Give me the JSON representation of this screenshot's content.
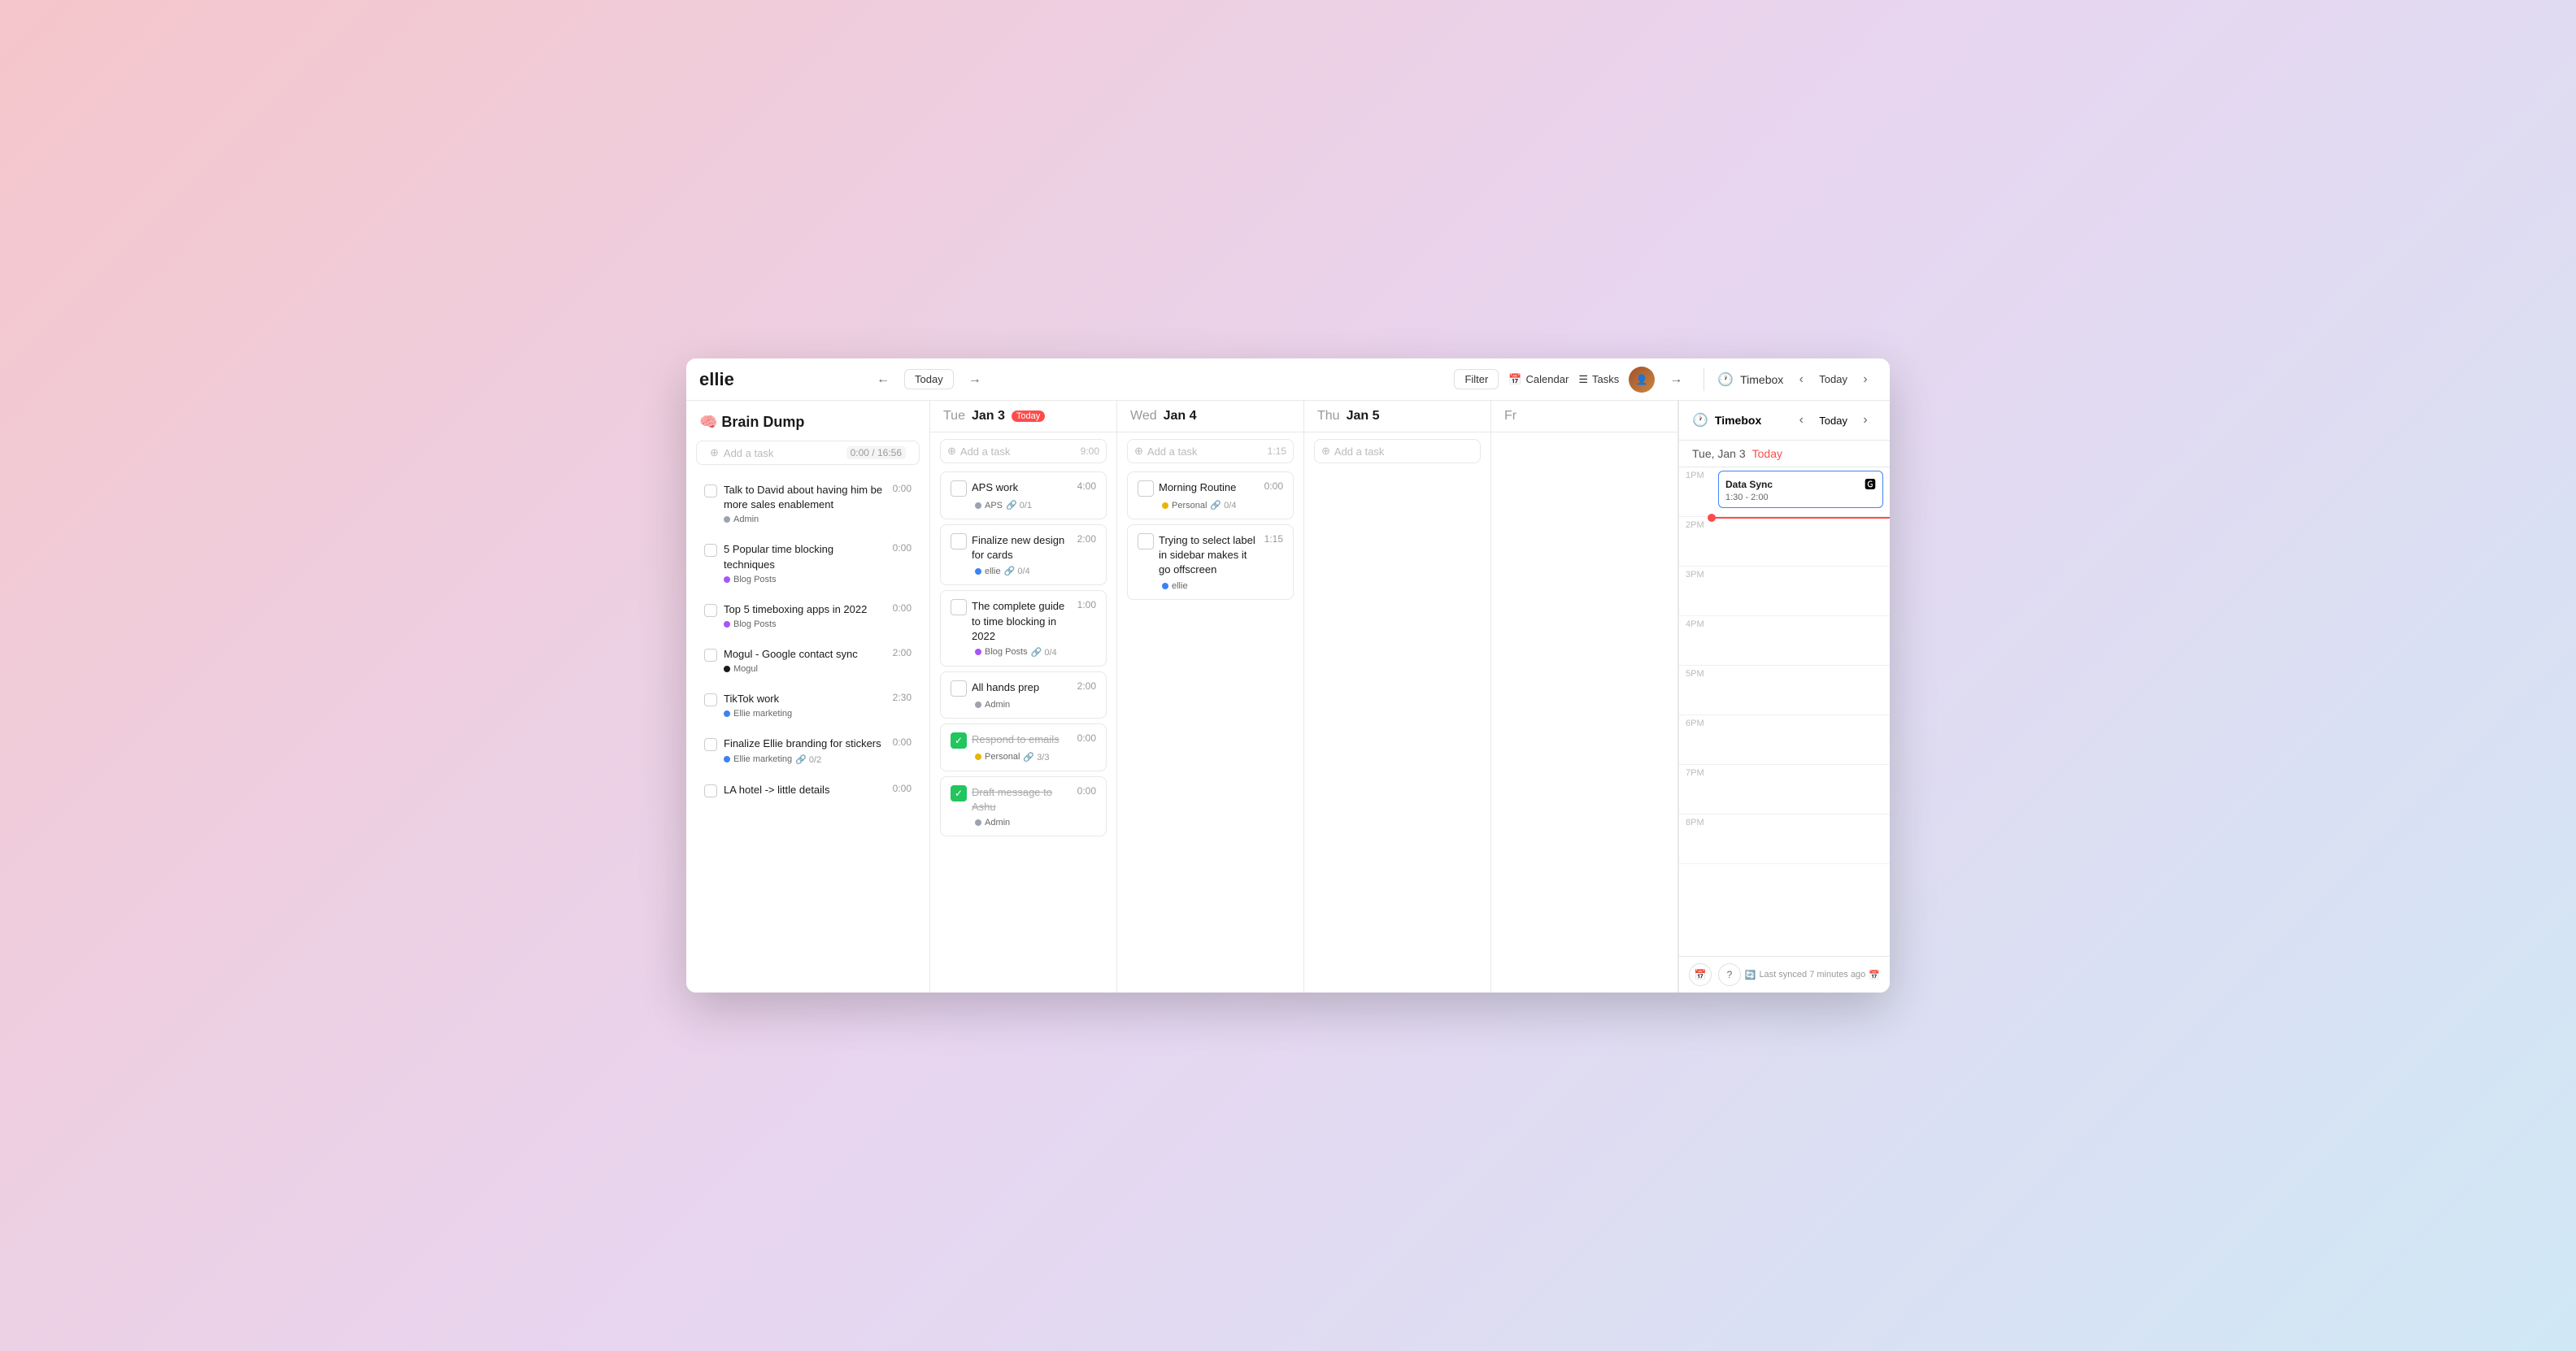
{
  "app": {
    "logo": "ellie",
    "brain_dump_title": "🧠 Brain Dump",
    "add_task_placeholder": "Add a task",
    "time_total": "0:00 / 16:56"
  },
  "header": {
    "today_btn": "Today",
    "filter_btn": "Filter",
    "calendar_btn": "Calendar",
    "tasks_btn": "Tasks",
    "timebox_label": "Timebox",
    "timebox_today": "Today"
  },
  "sidebar_tasks": [
    {
      "title": "Talk to David about having him be more sales enablement",
      "time": "0:00",
      "tag": "Admin",
      "tag_color": "#9ca3af",
      "checked": false
    },
    {
      "title": "5 Popular time blocking techniques",
      "time": "0:00",
      "tag": "Blog Posts",
      "tag_color": "#a855f7",
      "checked": false
    },
    {
      "title": "Top 5 timeboxing apps in 2022",
      "time": "0:00",
      "tag": "Blog Posts",
      "tag_color": "#a855f7",
      "checked": false
    },
    {
      "title": "Mogul - Google contact sync",
      "time": "2:00",
      "tag": "Mogul",
      "tag_color": "#1a1a1a",
      "checked": false
    },
    {
      "title": "TikTok work",
      "time": "2:30",
      "tag": "Ellie marketing",
      "tag_color": "#3b82f6",
      "checked": false
    },
    {
      "title": "Finalize Ellie branding for stickers",
      "time": "0:00",
      "tag": "Ellie marketing",
      "tag_color": "#3b82f6",
      "subtask": "0/2",
      "checked": false
    },
    {
      "title": "LA hotel -> little details",
      "time": "0:00",
      "tag": "",
      "checked": false
    }
  ],
  "days": [
    {
      "name": "Tue",
      "date": "Jan 3",
      "is_today": true,
      "add_time": "9:00",
      "tasks": [
        {
          "title": "APS work",
          "time": "4:00",
          "tag": "APS",
          "tag_color": "#9ca3af",
          "subtask": "0/1",
          "checked": false
        },
        {
          "title": "Finalize new design for cards",
          "time": "2:00",
          "tag": "ellie",
          "tag_color": "#3b82f6",
          "subtask": "0/4",
          "checked": false
        },
        {
          "title": "The complete guide to time blocking in 2022",
          "time": "1:00",
          "tag": "Blog Posts",
          "tag_color": "#a855f7",
          "subtask": "0/4",
          "checked": false
        },
        {
          "title": "All hands prep",
          "time": "2:00",
          "tag": "Admin",
          "tag_color": "#9ca3af",
          "checked": false
        },
        {
          "title": "Respond to emails",
          "time": "0:00",
          "tag": "Personal",
          "tag_color": "#eab308",
          "subtask": "3/3",
          "checked": true
        },
        {
          "title": "Draft message to Ashu",
          "time": "0:00",
          "tag": "Admin",
          "tag_color": "#9ca3af",
          "checked": true
        }
      ]
    },
    {
      "name": "Wed",
      "date": "Jan 4",
      "is_today": false,
      "add_time": "1:15",
      "tasks": [
        {
          "title": "Morning Routine",
          "time": "0:00",
          "tag": "Personal",
          "tag_color": "#eab308",
          "subtask": "0/4",
          "checked": false
        },
        {
          "title": "Trying to select label in sidebar makes it go offscreen",
          "time": "1:15",
          "tag": "ellie",
          "tag_color": "#3b82f6",
          "checked": false
        }
      ]
    },
    {
      "name": "Thu",
      "date": "Jan 5",
      "is_today": false,
      "add_time": "",
      "tasks": []
    },
    {
      "name": "Fr",
      "date": "",
      "is_today": false,
      "add_time": "",
      "tasks": []
    }
  ],
  "timebox": {
    "title": "Timebox",
    "today": "Today",
    "date_display": "Tue, Jan 3",
    "today_label": "Today",
    "event": {
      "title": "Data Sync",
      "time": "1:30 - 2:00"
    },
    "time_slots": [
      "1PM",
      "2PM",
      "3PM",
      "4PM",
      "5PM",
      "6PM",
      "7PM",
      "8PM"
    ],
    "last_synced": "Last synced 7 minutes ago"
  }
}
